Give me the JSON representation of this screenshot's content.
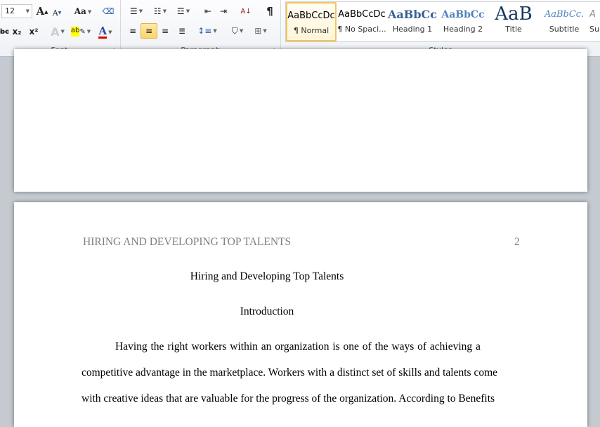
{
  "ribbon": {
    "font_group": {
      "label": "Font",
      "font_size": "12",
      "grow": "A",
      "shrink": "A",
      "change_case": "Aa",
      "strike": "abc",
      "subscript": "x₂",
      "superscript": "x²",
      "text_effects": "A",
      "highlight": "ab",
      "font_color": "A",
      "highlight_color": "#ffff00",
      "font_color_value": "#e00000"
    },
    "paragraph_group": {
      "label": "Paragraph",
      "sort": "A↓",
      "pilcrow": "¶"
    },
    "styles_group": {
      "label": "Styles",
      "items": [
        {
          "preview": "AaBbCcDc",
          "name": "¶ Normal",
          "selected": true
        },
        {
          "preview": "AaBbCcDc",
          "name": "¶ No Spaci..."
        },
        {
          "preview": "AaBbCc",
          "name": "Heading 1"
        },
        {
          "preview": "AaBbCc",
          "name": "Heading 2"
        },
        {
          "preview": "AaB",
          "name": "Title"
        },
        {
          "preview": "AaBbCc.",
          "name": "Subtitle"
        },
        {
          "preview": "A",
          "name": "Su"
        }
      ]
    }
  },
  "document": {
    "header_text": "HIRING AND DEVELOPING TOP TALENTS",
    "page_number": "2",
    "title": "Hiring and Developing Top Talents",
    "heading": "Introduction",
    "lines": [
      "Having the right workers within an organization is one of the ways of achieving a",
      "competitive advantage in the marketplace.  Workers with a distinct set of skills and talents come",
      "with creative ideas that are valuable for the progress of the organization.  According to Benefits"
    ]
  }
}
